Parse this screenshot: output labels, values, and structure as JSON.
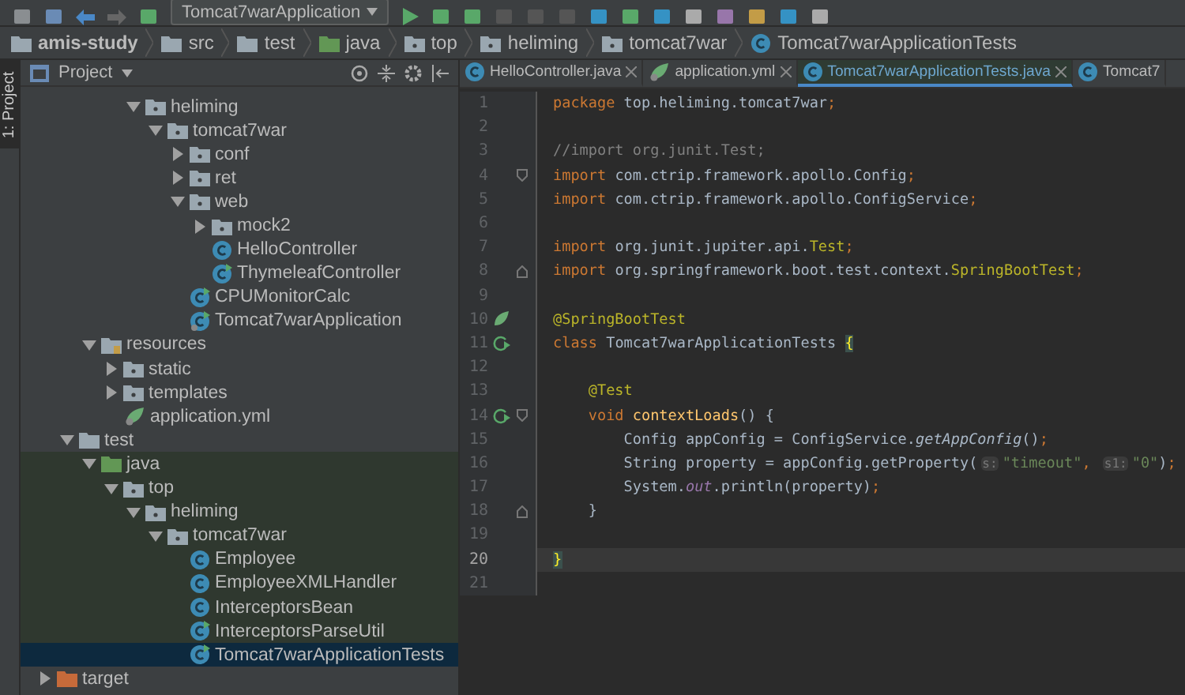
{
  "toolbar": {
    "run_config": "Tomcat7warApplication"
  },
  "breadcrumbs": [
    {
      "label": "amis-study",
      "kind": "project"
    },
    {
      "label": "src",
      "kind": "folder"
    },
    {
      "label": "test",
      "kind": "folder"
    },
    {
      "label": "java",
      "kind": "testroot"
    },
    {
      "label": "top",
      "kind": "package"
    },
    {
      "label": "heliming",
      "kind": "package"
    },
    {
      "label": "tomcat7war",
      "kind": "package"
    },
    {
      "label": "Tomcat7warApplicationTests",
      "kind": "class"
    }
  ],
  "side_strip": {
    "label": "1: Project"
  },
  "project_panel": {
    "title": "Project"
  },
  "tree": [
    {
      "label": "heliming",
      "kind": "package",
      "expanded": true,
      "selected": false,
      "children": [
        {
          "label": "tomcat7war",
          "kind": "package",
          "expanded": true,
          "selected": false,
          "children": [
            {
              "label": "conf",
              "kind": "package",
              "expanded": false,
              "selected": false
            },
            {
              "label": "ret",
              "kind": "package",
              "expanded": false,
              "selected": false
            },
            {
              "label": "web",
              "kind": "package",
              "expanded": true,
              "selected": false,
              "children": [
                {
                  "label": "mock2",
                  "kind": "package",
                  "expanded": false,
                  "selected": false
                },
                {
                  "label": "HelloController",
                  "kind": "class",
                  "selected": false
                },
                {
                  "label": "ThymeleafController",
                  "kind": "runclass",
                  "selected": false
                }
              ]
            },
            {
              "label": "CPUMonitorCalc",
              "kind": "runclass",
              "selected": false
            },
            {
              "label": "Tomcat7warApplication",
              "kind": "springapp",
              "selected": false
            }
          ]
        }
      ]
    },
    {
      "label": "resources",
      "kind": "resources",
      "expanded": true,
      "selected": false,
      "children": [
        {
          "label": "static",
          "kind": "package",
          "expanded": false,
          "selected": false
        },
        {
          "label": "templates",
          "kind": "package",
          "expanded": false,
          "selected": false
        },
        {
          "label": "application.yml",
          "kind": "yml",
          "selected": false
        }
      ]
    },
    {
      "label": "test",
      "kind": "folder",
      "expanded": true,
      "selected": false,
      "children": [
        {
          "label": "java",
          "kind": "testroot",
          "expanded": true,
          "selected": false,
          "children": [
            {
              "label": "top",
              "kind": "package",
              "expanded": true,
              "selected": false,
              "children": [
                {
                  "label": "heliming",
                  "kind": "package",
                  "expanded": true,
                  "selected": false,
                  "children": [
                    {
                      "label": "tomcat7war",
                      "kind": "package",
                      "expanded": true,
                      "selected": false,
                      "children": [
                        {
                          "label": "Employee",
                          "kind": "class",
                          "selected": false
                        },
                        {
                          "label": "EmployeeXMLHandler",
                          "kind": "class",
                          "selected": false
                        },
                        {
                          "label": "InterceptorsBean",
                          "kind": "class",
                          "selected": false
                        },
                        {
                          "label": "InterceptorsParseUtil",
                          "kind": "runclass",
                          "selected": false
                        },
                        {
                          "label": "Tomcat7warApplicationTests",
                          "kind": "runclass",
                          "selected": true
                        }
                      ]
                    }
                  ]
                }
              ]
            }
          ]
        }
      ]
    },
    {
      "label": "target",
      "kind": "excluded",
      "expanded": false,
      "selected": false
    }
  ],
  "tabs": [
    {
      "label": "HelloController.java",
      "kind": "class",
      "selected": false
    },
    {
      "label": "application.yml",
      "kind": "yml",
      "selected": false
    },
    {
      "label": "Tomcat7warApplicationTests.java",
      "kind": "class",
      "selected": true
    },
    {
      "label": "Tomcat7",
      "kind": "class",
      "selected": false
    }
  ],
  "code": [
    {
      "number": "1",
      "current": false,
      "tokens": [
        {
          "kind": "kw",
          "text": "package "
        },
        {
          "kind": "plain",
          "text": "top.heliming.tomcat7war"
        },
        {
          "kind": "kw",
          "text": ";"
        }
      ]
    },
    {
      "number": "2",
      "current": false
    },
    {
      "number": "3",
      "current": false,
      "tokens": [
        {
          "kind": "comment",
          "text": "//import org.junit.Test;"
        }
      ]
    },
    {
      "number": "4",
      "current": false,
      "tokens": [
        {
          "kind": "kw",
          "text": "import "
        },
        {
          "kind": "plain",
          "text": "com.ctrip.framework.apollo.Config"
        },
        {
          "kind": "kw",
          "text": ";"
        }
      ]
    },
    {
      "number": "5",
      "current": false,
      "tokens": [
        {
          "kind": "kw",
          "text": "import "
        },
        {
          "kind": "plain",
          "text": "com.ctrip.framework.apollo.ConfigService"
        },
        {
          "kind": "kw",
          "text": ";"
        }
      ]
    },
    {
      "number": "6",
      "current": false
    },
    {
      "number": "7",
      "current": false,
      "tokens": [
        {
          "kind": "kw",
          "text": "import "
        },
        {
          "kind": "plain",
          "text": "org.junit.jupiter.api."
        },
        {
          "kind": "anno",
          "text": "Test"
        },
        {
          "kind": "kw",
          "text": ";"
        }
      ]
    },
    {
      "number": "8",
      "current": false,
      "tokens": [
        {
          "kind": "kw",
          "text": "import "
        },
        {
          "kind": "plain",
          "text": "org.springframework.boot.test.context."
        },
        {
          "kind": "anno",
          "text": "SpringBootTest"
        },
        {
          "kind": "kw",
          "text": ";"
        }
      ]
    },
    {
      "number": "9",
      "current": false
    },
    {
      "number": "10",
      "current": false,
      "tokens": [
        {
          "kind": "anno",
          "text": "@SpringBootTest"
        }
      ]
    },
    {
      "number": "11",
      "current": false,
      "tokens": [
        {
          "kind": "kw",
          "text": "class "
        },
        {
          "kind": "plain",
          "text": "Tomcat7warApplicationTests "
        },
        {
          "kind": "brace",
          "text": "{"
        }
      ]
    },
    {
      "number": "12",
      "current": false
    },
    {
      "number": "13",
      "current": false,
      "tokens": [
        {
          "kind": "anno",
          "text": "    @Test"
        }
      ]
    },
    {
      "number": "14",
      "current": false,
      "tokens": [
        {
          "kind": "kw",
          "text": "    void "
        },
        {
          "kind": "method",
          "text": "contextLoads"
        },
        {
          "kind": "plain",
          "text": "() {"
        }
      ]
    },
    {
      "number": "15",
      "current": false,
      "tokens": [
        {
          "kind": "plain",
          "text": "        Config appConfig = ConfigService."
        },
        {
          "kind": "static",
          "text": "getAppConfig"
        },
        {
          "kind": "plain",
          "text": "()"
        },
        {
          "kind": "kw",
          "text": ";"
        }
      ]
    },
    {
      "number": "16",
      "current": false,
      "tokens": [
        {
          "kind": "plain",
          "text": "        String property = appConfig.getProperty("
        },
        {
          "kind": "hint",
          "text": "s:"
        },
        {
          "kind": "str",
          "text": "\"timeout\""
        },
        {
          "kind": "kw",
          "text": ", "
        },
        {
          "kind": "hint",
          "text": "s1:"
        },
        {
          "kind": "str",
          "text": "\"0\""
        },
        {
          "kind": "plain",
          "text": ")"
        },
        {
          "kind": "kw",
          "text": ";"
        }
      ]
    },
    {
      "number": "17",
      "current": false,
      "tokens": [
        {
          "kind": "plain",
          "text": "        System."
        },
        {
          "kind": "field",
          "text": "out"
        },
        {
          "kind": "plain",
          "text": ".println(property)"
        },
        {
          "kind": "kw",
          "text": ";"
        }
      ]
    },
    {
      "number": "18",
      "current": false,
      "tokens": [
        {
          "kind": "plain",
          "text": "    }"
        }
      ]
    },
    {
      "number": "19",
      "current": false
    },
    {
      "number": "20",
      "current": true,
      "tokens": [
        {
          "kind": "brace",
          "text": "}"
        }
      ]
    },
    {
      "number": "21",
      "current": false
    }
  ]
}
